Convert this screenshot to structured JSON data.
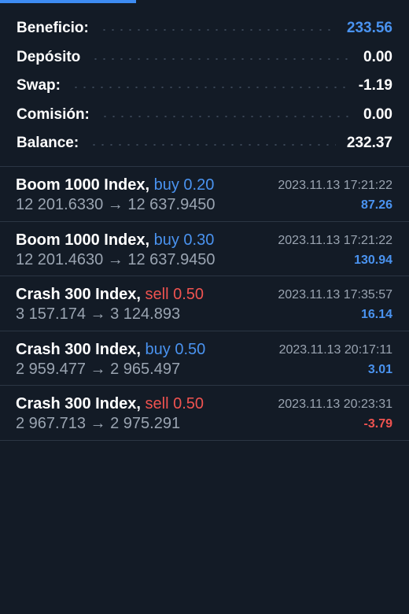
{
  "colors": {
    "background": "#131b26",
    "accent_blue": "#4a93f0",
    "sell_red": "#ef5350",
    "muted_text": "#9aa4b1",
    "divider": "#2b3644"
  },
  "summary": {
    "rows": [
      {
        "label": "Beneficio:",
        "value": "233.56",
        "accent": true
      },
      {
        "label": "Depósito",
        "value": "0.00",
        "accent": false
      },
      {
        "label": "Swap:",
        "value": "-1.19",
        "accent": false
      },
      {
        "label": "Comisión:",
        "value": "0.00",
        "accent": false
      },
      {
        "label": "Balance:",
        "value": "232.37",
        "accent": false
      }
    ]
  },
  "deals": [
    {
      "symbol": "Boom 1000 Index,",
      "side": "buy",
      "side_text": "buy 0.20",
      "prices": "12 201.6330 → 12 637.9450",
      "time": "2023.11.13 17:21:22",
      "profit": "87.26"
    },
    {
      "symbol": "Boom 1000 Index,",
      "side": "buy",
      "side_text": "buy 0.30",
      "prices": "12 201.4630 → 12 637.9450",
      "time": "2023.11.13 17:21:22",
      "profit": "130.94"
    },
    {
      "symbol": "Crash 300 Index,",
      "side": "sell",
      "side_text": "sell 0.50",
      "prices": "3 157.174 → 3 124.893",
      "time": "2023.11.13 17:35:57",
      "profit": "16.14"
    },
    {
      "symbol": "Crash 300 Index,",
      "side": "buy",
      "side_text": "buy 0.50",
      "prices": "2 959.477 → 2 965.497",
      "time": "2023.11.13 20:17:11",
      "profit": "3.01"
    },
    {
      "symbol": "Crash 300 Index,",
      "side": "sell",
      "side_text": "sell 0.50",
      "prices": "2 967.713 → 2 975.291",
      "time": "2023.11.13 20:23:31",
      "profit": "-3.79"
    }
  ]
}
